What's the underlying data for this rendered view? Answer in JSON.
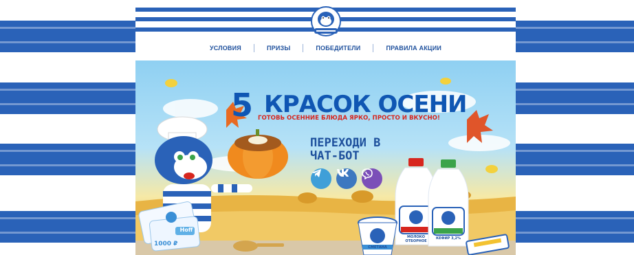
{
  "nav": {
    "items": [
      "УСЛОВИЯ",
      "ПРИЗЫ",
      "ПОБЕДИТЕЛИ",
      "ПРАВИЛА АКЦИИ"
    ]
  },
  "hero": {
    "title_number": "5",
    "title_text": "КРАСОК ОСЕНИ",
    "subtitle": "ГОТОВЬ ОСЕННИЕ БЛЮДА ЯРКО, ПРОСТО И ВКУСНО!",
    "cta": "ПЕРЕХОДИ В ЧАТ-БОТ",
    "social": [
      "telegram-icon",
      "vk-icon",
      "viber-icon"
    ]
  },
  "products": {
    "milk": "МОЛОКО ОТБОРНОЕ",
    "kefir": "КЕФИР 3,2%",
    "smetana": "СМЕТАНА"
  },
  "voucher": {
    "brand": "Hoff",
    "amount": "1000 ₽"
  },
  "colors": {
    "brand_blue": "#2a62b8",
    "title_blue": "#0f56b3",
    "accent_red": "#d7261e"
  }
}
